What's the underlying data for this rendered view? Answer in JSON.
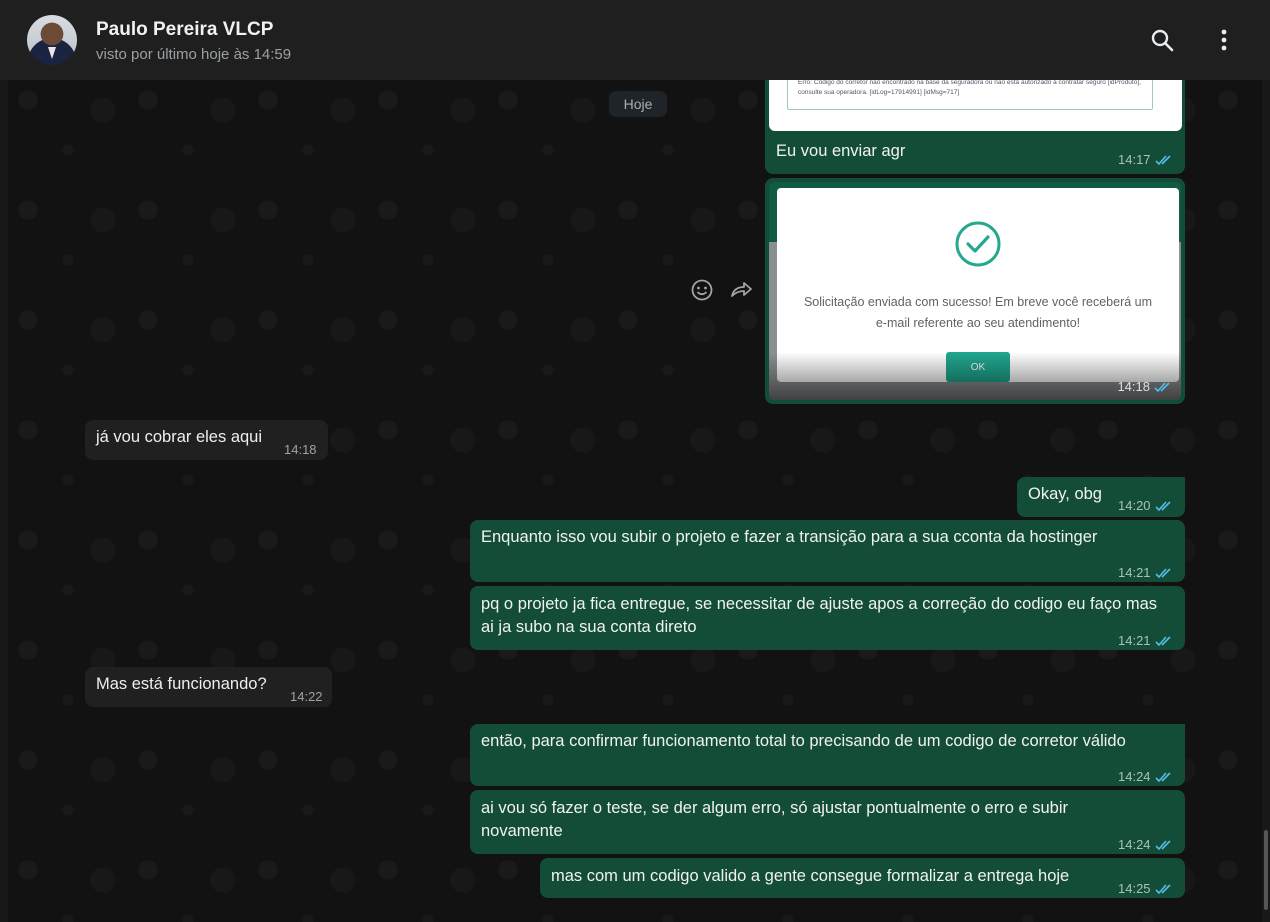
{
  "header": {
    "contact_name": "Paulo Pereira VLCP",
    "contact_status": "visto por último hoje às 14:59",
    "icons": [
      "avatar",
      "search-icon",
      "menu-icon"
    ]
  },
  "date_separator": "Hoje",
  "image_message_1": {
    "snippet": "Erro: Código do corretor não encontrado na base da seguradora ou não está autorizado a contratar seguro [idProduto], consulte sua operadora. [idLog=17914991] [idMsg=717]"
  },
  "image_message_2": {
    "dialog_text": "Solicitação enviada com sucesso! Em breve você receberá um e-mail referente ao seu atendimento!",
    "button_label": "OK",
    "time": "14:18"
  },
  "messages": [
    {
      "dir": "out",
      "text": "Eu vou enviar agr",
      "time": "14:17"
    },
    {
      "dir": "in",
      "text": "já vou cobrar eles aqui",
      "time": "14:18"
    },
    {
      "dir": "out",
      "text": "Okay, obg",
      "time": "14:20"
    },
    {
      "dir": "out",
      "text": "Enquanto isso vou subir o projeto e fazer a transição para a sua cconta da hostinger",
      "time": "14:21"
    },
    {
      "dir": "out",
      "text": "pq o projeto ja fica entregue, se necessitar de ajuste apos a correção do codigo eu faço mas ai ja subo na sua conta direto",
      "time": "14:21"
    },
    {
      "dir": "in",
      "text": "Mas está funcionando?",
      "time": "14:22"
    },
    {
      "dir": "out",
      "text": "então, para confirmar funcionamento total to precisando de um codigo de corretor válido",
      "time": "14:24"
    },
    {
      "dir": "out",
      "text": "ai vou só fazer o teste, se der algum erro, só ajustar pontualmente o erro e subir novamente",
      "time": "14:24"
    },
    {
      "dir": "out",
      "text": "mas com um codigo valido a gente consegue formalizar a entrega hoje",
      "time": "14:25"
    }
  ],
  "colors": {
    "outgoing_bubble": "#144d37",
    "incoming_bubble": "#202020",
    "read_ticks": "#53bdeb",
    "background": "#121212"
  }
}
